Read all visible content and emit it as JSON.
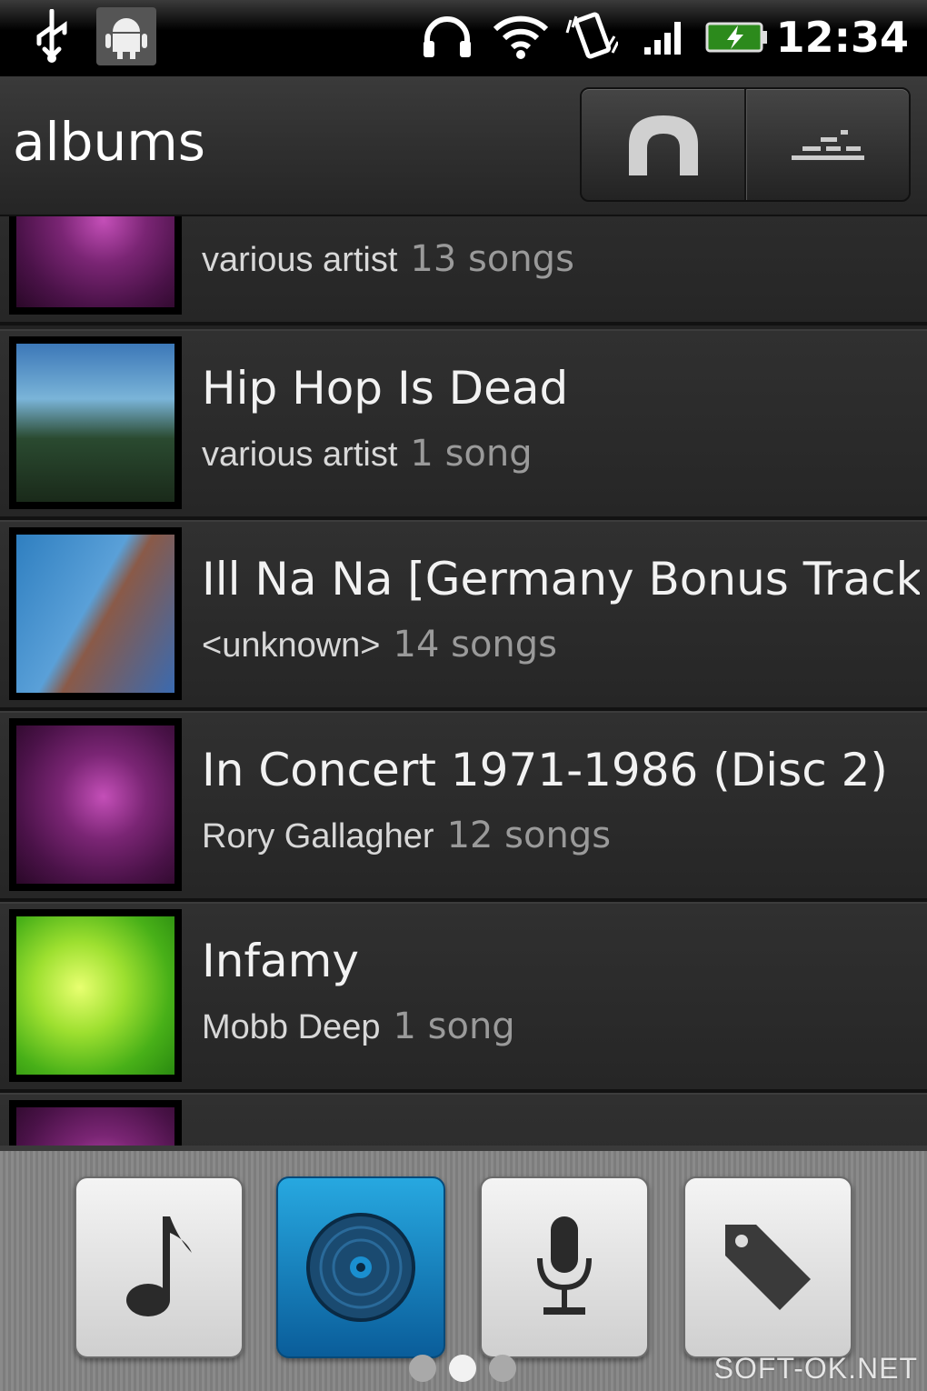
{
  "status_bar": {
    "time": "12:34",
    "icons": [
      "usb-icon",
      "android-debug-icon",
      "headphones-icon",
      "wifi-icon",
      "vibrate-icon",
      "signal-icon",
      "battery-charging-icon"
    ]
  },
  "header": {
    "title": "albums",
    "buttons": [
      "home-icon",
      "now-playing-icon"
    ]
  },
  "albums": [
    {
      "title": "",
      "artist": "various artist",
      "count": "13 songs",
      "art": "purple"
    },
    {
      "title": "Hip Hop Is Dead",
      "artist": "various artist",
      "count": "1 song",
      "art": "nas"
    },
    {
      "title": "Ill Na Na [Germany Bonus Tracks",
      "artist": "<unknown>",
      "count": "14 songs",
      "art": "foxy"
    },
    {
      "title": "In Concert 1971-1986 (Disc 2)",
      "artist": "Rory Gallagher",
      "count": "12 songs",
      "art": "purple"
    },
    {
      "title": "Infamy",
      "artist": "Mobb Deep",
      "count": "1 song",
      "art": "green"
    }
  ],
  "bottom_tabs": [
    {
      "icon": "music-note-icon",
      "active": false
    },
    {
      "icon": "album-disc-icon",
      "active": true
    },
    {
      "icon": "microphone-icon",
      "active": false
    },
    {
      "icon": "tag-icon",
      "active": false
    }
  ],
  "page_indicator": {
    "pages": 3,
    "current": 2
  },
  "watermark": "SOFT-OK.NET",
  "colors": {
    "accent": "#1a8fd0",
    "background": "#262626"
  }
}
